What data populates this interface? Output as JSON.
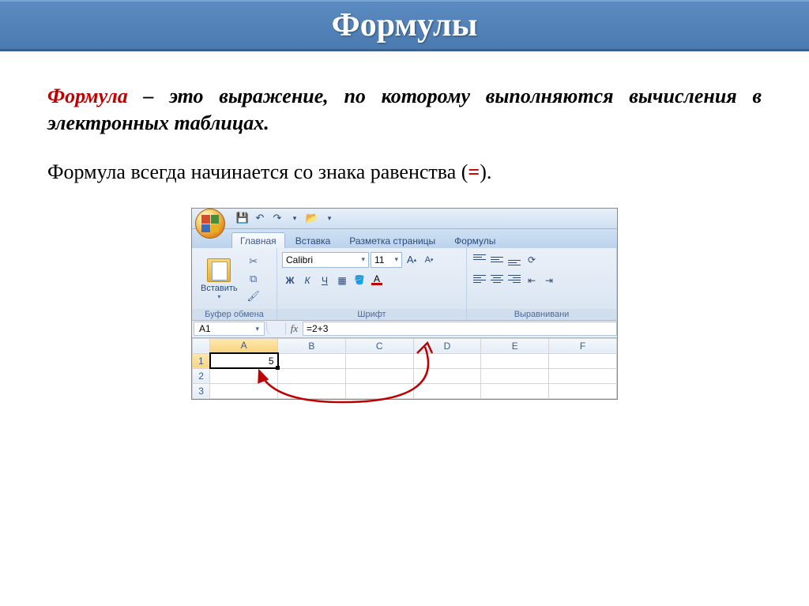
{
  "slide": {
    "title": "Формулы",
    "definition_term": "Формула",
    "definition_rest": " – это выражение, по которому выполняются вычисления в электронных таблицах.",
    "subtext_before": "Формула всегда начинается со знака равенства (",
    "subtext_eq": "=",
    "subtext_after": ")."
  },
  "qat": {
    "save_title": "Сохранить",
    "undo_title": "Отменить",
    "redo_title": "Вернуть",
    "open_title": "Открыть"
  },
  "tabs": [
    "Главная",
    "Вставка",
    "Разметка страницы",
    "Формулы"
  ],
  "ribbon": {
    "clipboard": {
      "paste": "Вставить",
      "group_label": "Буфер обмена"
    },
    "font": {
      "name": "Calibri",
      "size": "11",
      "bold": "Ж",
      "italic": "К",
      "underline": "Ч",
      "group_label": "Шрифт"
    },
    "align": {
      "group_label": "Выравнивани"
    }
  },
  "formula_bar": {
    "name_box": "A1",
    "fx": "fx",
    "formula": "=2+3"
  },
  "grid": {
    "columns": [
      "A",
      "B",
      "C",
      "D",
      "E",
      "F"
    ],
    "rows": [
      "1",
      "2",
      "3"
    ],
    "cell_A1": "5"
  }
}
